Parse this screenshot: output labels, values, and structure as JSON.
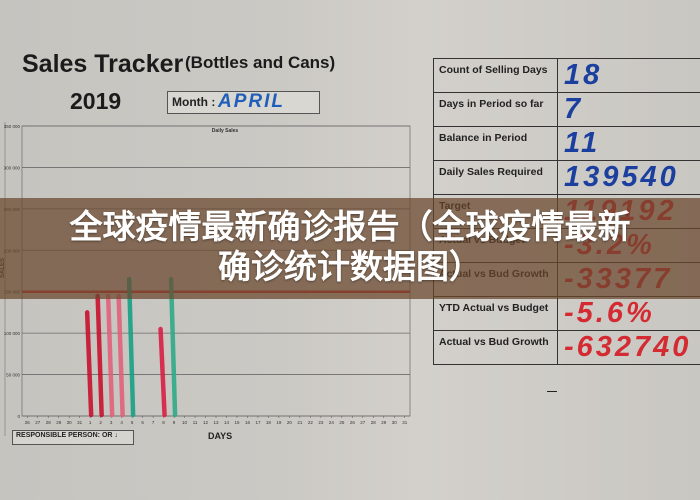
{
  "header": {
    "title": "Sales Tracker",
    "subtitle": "(Bottles and Cans)",
    "year": "2019",
    "month_label": "Month :",
    "month_value": "APRIL"
  },
  "chart_data": {
    "type": "bar",
    "title": "Daily Sales",
    "xlabel": "DAYS",
    "ylabel": "SALES",
    "ylim": [
      0,
      350000
    ],
    "yticks": [
      0,
      50000,
      100000,
      150000,
      200000,
      250000,
      300000,
      350000
    ],
    "ytick_labels": [
      "0",
      "50 000",
      "100 000",
      "150 000",
      "200 000",
      "250 000",
      "300 000",
      "350 000"
    ],
    "grid": true,
    "categories": [
      "26",
      "27",
      "28",
      "29",
      "30",
      "31",
      "1",
      "2",
      "3",
      "4",
      "5",
      "6",
      "7",
      "8",
      "9",
      "10",
      "11",
      "12",
      "13",
      "14",
      "15",
      "16",
      "17",
      "18",
      "19",
      "20",
      "21",
      "22",
      "23",
      "24",
      "25",
      "26",
      "27",
      "28",
      "29",
      "30",
      "31"
    ],
    "target_line": {
      "value": 150000,
      "color": "#c8323a"
    },
    "series": [
      {
        "name": "Daily Sales (hand-drawn)",
        "values": [
          null,
          null,
          null,
          null,
          null,
          null,
          125000,
          145000,
          145000,
          145000,
          165000,
          null,
          null,
          105000,
          165000,
          null,
          null,
          null,
          null,
          null,
          null,
          null,
          null,
          null,
          null,
          null,
          null,
          null,
          null,
          null,
          null,
          null,
          null,
          null,
          null,
          null,
          null
        ],
        "colors": {
          "1": "#c8102e",
          "2": "#c8102e",
          "3": "#e0607a",
          "4": "#e0607a",
          "5": "#16a085",
          "8": "#d81e44",
          "9": "#2eaa88"
        }
      }
    ]
  },
  "responsible": {
    "label": "RESPONSIBLE PERSON: OR",
    "mark": "↓"
  },
  "kpi_table": {
    "rows": [
      {
        "label": "Count of Selling Days",
        "value": "18",
        "color": "blue"
      },
      {
        "label": "Days in Period so far",
        "value": "7",
        "color": "blue"
      },
      {
        "label": "Balance in Period",
        "value": "11",
        "color": "blue"
      },
      {
        "label": "Daily Sales Required",
        "value": "139540",
        "color": "blue"
      },
      {
        "label": "Target",
        "value": "119192",
        "color": "red"
      },
      {
        "label": "Actual vs Budget",
        "value": "-3.2%",
        "color": "red"
      },
      {
        "label": "Actual vs Bud Growth",
        "value": "-33377",
        "color": "red"
      },
      {
        "label": "YTD Actual vs Budget",
        "value": "-5.6%",
        "color": "red"
      },
      {
        "label": "Actual vs Bud Growth",
        "value": "-632740",
        "color": "red"
      }
    ]
  },
  "banner": {
    "line1": "全球疫情最新确诊报告（全球疫情最新",
    "line2": "确诊统计数据图）"
  }
}
